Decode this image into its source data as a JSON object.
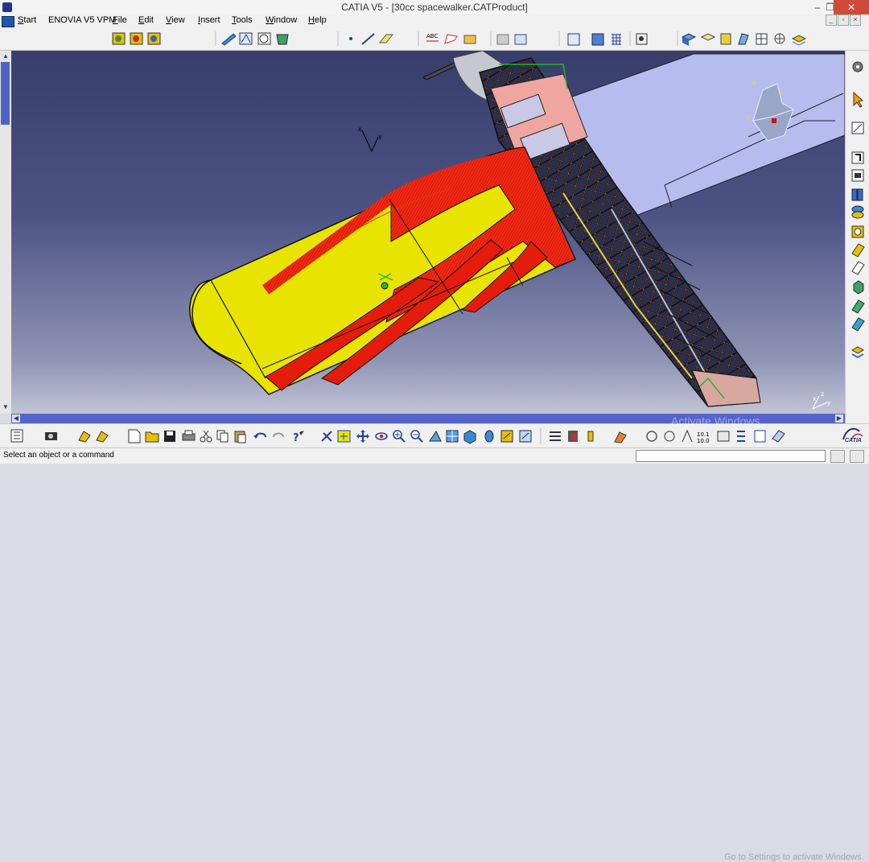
{
  "window": {
    "title": "CATIA V5 - [30cc spacewalker.CATProduct]",
    "controls": {
      "minimize": "–",
      "restore": "❐",
      "close": "✕"
    }
  },
  "menubar": {
    "items": [
      {
        "label": "Start",
        "underline": "S",
        "rest": "tart"
      },
      {
        "label": "ENOVIA V5 VPM"
      },
      {
        "label": "File",
        "underline": "F",
        "rest": "ile"
      },
      {
        "label": "Edit",
        "underline": "E",
        "rest": "dit"
      },
      {
        "label": "View",
        "underline": "V",
        "rest": "iew"
      },
      {
        "label": "Insert",
        "underline": "I",
        "rest": "nsert"
      },
      {
        "label": "Tools",
        "underline": "T",
        "rest": "ools"
      },
      {
        "label": "Window",
        "underline": "W",
        "rest": "indow"
      },
      {
        "label": "Help",
        "underline": "H",
        "rest": "elp"
      }
    ]
  },
  "viewport": {
    "axis_labels": {
      "x": "x",
      "y": "y",
      "z": "z"
    },
    "colors": {
      "wing": "#e8e400",
      "spar": "#ee1a0a",
      "frame": "#b0b8ee",
      "background_top": "#383e6a",
      "background_bottom": "#c2c4d6"
    }
  },
  "status": {
    "message": "Select an object or a command",
    "command_value": ""
  },
  "watermark": {
    "line1": "Activate Windows",
    "line2": "Go to Settings to activate Windows."
  },
  "brand": {
    "name": "CATIA",
    "version_mark": "3S"
  },
  "toolbars": {
    "top_icons": [
      "product-icon",
      "part-icon",
      "component-icon",
      "catalog-icon",
      "snap-icon",
      "constraint-icon",
      "manipulate-icon",
      "point-icon",
      "line-icon",
      "plane-icon",
      "text-icon",
      "flag-note-icon",
      "measure-icon",
      "section-icon",
      "clash-icon",
      "sectioning-icon",
      "grid-icon",
      "compass-icon",
      "render-icon",
      "view-mode-icon"
    ],
    "right_icons": [
      "gear-icon",
      "select-cursor-icon",
      "sketch-icon",
      "plane-icon",
      "pad-icon",
      "pocket-icon",
      "shaft-icon",
      "hole-icon",
      "rib-icon",
      "slot-icon",
      "stiffener-icon",
      "loft-icon",
      "draft-icon",
      "thickness-icon",
      "layers-icon"
    ],
    "bottom_icons": [
      "tree-icon",
      "camera-icon",
      "new-icon",
      "open-icon",
      "save-icon",
      "print-icon",
      "cut-icon",
      "copy-icon",
      "paste-icon",
      "undo-icon",
      "redo-icon",
      "help-icon",
      "fly-icon",
      "fit-all-icon",
      "pan-icon",
      "rotate-icon",
      "zoom-in-icon",
      "zoom-out-icon",
      "normal-view-icon",
      "multi-view-icon",
      "iso-view-icon",
      "shading-icon",
      "hide-show-icon",
      "swap-icon",
      "layer-icon",
      "properties-icon",
      "scale-icon",
      "measure-icon"
    ]
  }
}
